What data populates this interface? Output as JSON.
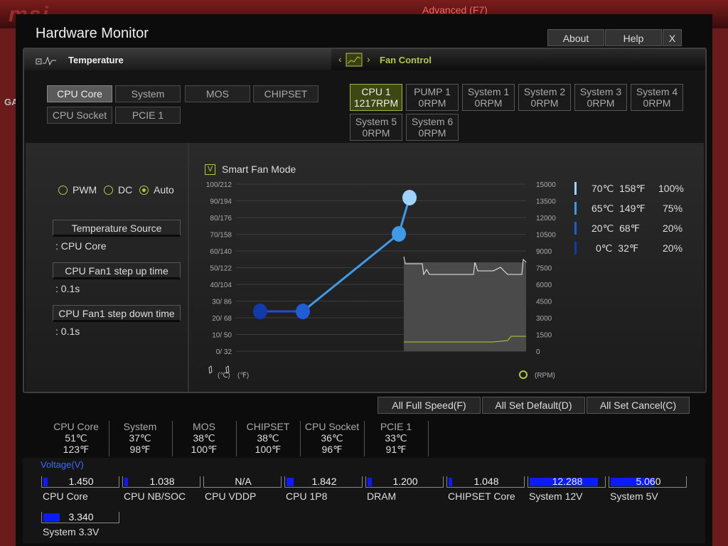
{
  "window": {
    "title": "Hardware Monitor",
    "about": "About",
    "help": "Help",
    "close": "X"
  },
  "background": {
    "brand": "msi",
    "advanced": "Advanced (F7)",
    "side_label": "GA"
  },
  "tabs": {
    "temperature": "Temperature",
    "fan_control": "Fan Control"
  },
  "temp_sources": [
    {
      "label": "CPU Core",
      "active": true
    },
    {
      "label": "System"
    },
    {
      "label": "MOS"
    },
    {
      "label": "CHIPSET"
    },
    {
      "label": "CPU Socket"
    },
    {
      "label": "PCIE 1"
    }
  ],
  "fans": [
    {
      "name": "CPU 1",
      "rpm": "1217RPM",
      "active": true
    },
    {
      "name": "PUMP 1",
      "rpm": "0RPM"
    },
    {
      "name": "System 1",
      "rpm": "0RPM"
    },
    {
      "name": "System 2",
      "rpm": "0RPM"
    },
    {
      "name": "System 3",
      "rpm": "0RPM"
    },
    {
      "name": "System 4",
      "rpm": "0RPM"
    },
    {
      "name": "System 5",
      "rpm": "0RPM"
    },
    {
      "name": "System 6",
      "rpm": "0RPM"
    }
  ],
  "mode": {
    "pwm": "PWM",
    "dc": "DC",
    "auto": "Auto",
    "selected": "Auto"
  },
  "settings": {
    "temp_source_label": "Temperature Source",
    "temp_source_value": ": CPU Core",
    "step_up_label": "CPU Fan1 step up time",
    "step_up_value": ": 0.1s",
    "step_down_label": "CPU Fan1 step down time",
    "step_down_value": ": 0.1s"
  },
  "smart_fan": {
    "label": "Smart Fan Mode",
    "checked": true,
    "check_glyph": "V"
  },
  "chart_data": {
    "type": "line",
    "title": "",
    "y_left_ticks": [
      "100/212",
      "90/194",
      "80/176",
      "70/158",
      "60/140",
      "50/122",
      "40/104",
      "30/ 86",
      "20/ 68",
      "10/ 50",
      "0/ 32"
    ],
    "y_right_ticks": [
      "15000",
      "13500",
      "12000",
      "10500",
      "9000",
      "7500",
      "6000",
      "4500",
      "3000",
      "1500",
      "0"
    ],
    "ylim_percent": [
      0,
      100
    ],
    "series": [
      {
        "values": [
          [
            0,
            20
          ],
          [
            20,
            20
          ],
          [
            65,
            75
          ],
          [
            70,
            100
          ]
        ]
      }
    ],
    "left_unit": "(℃)",
    "left_unit2": "(℉)",
    "right_unit": "(RPM)"
  },
  "curve_legend": [
    {
      "c": "70℃",
      "f": "158℉",
      "pct": "100%",
      "color": "#9fd3ff"
    },
    {
      "c": "65℃",
      "f": "149℉",
      "pct": "75%",
      "color": "#3f9be8"
    },
    {
      "c": "20℃",
      "f": "68℉",
      "pct": "20%",
      "color": "#1f5cd8"
    },
    {
      "c": "0℃",
      "f": "32℉",
      "pct": "20%",
      "color": "#123aa8"
    }
  ],
  "actions": {
    "full_speed": "All Full Speed(F)",
    "set_default": "All Set Default(D)",
    "set_cancel": "All Set Cancel(C)"
  },
  "temps": [
    {
      "name": "CPU Core",
      "c": "51℃",
      "f": "123℉"
    },
    {
      "name": "System",
      "c": "37℃",
      "f": "98℉"
    },
    {
      "name": "MOS",
      "c": "38℃",
      "f": "100℉"
    },
    {
      "name": "CHIPSET",
      "c": "38℃",
      "f": "100℉"
    },
    {
      "name": "CPU Socket",
      "c": "36℃",
      "f": "96℉"
    },
    {
      "name": "PCIE 1",
      "c": "33℃",
      "f": "91℉"
    }
  ],
  "voltage": {
    "title": "Voltage(V)",
    "items": [
      {
        "name": "CPU Core",
        "value": "1.450",
        "fill": 0.06
      },
      {
        "name": "CPU NB/SOC",
        "value": "1.038",
        "fill": 0.05
      },
      {
        "name": "CPU VDDP",
        "value": "N/A",
        "fill": 0
      },
      {
        "name": "CPU 1P8",
        "value": "1.842",
        "fill": 0.1
      },
      {
        "name": "DRAM",
        "value": "1.200",
        "fill": 0.06
      },
      {
        "name": "CHIPSET Core",
        "value": "1.048",
        "fill": 0.05
      },
      {
        "name": "System 12V",
        "value": "12.288",
        "fill": 0.92
      },
      {
        "name": "System 5V",
        "value": "5.060",
        "fill": 0.6
      },
      {
        "name": "System 3.3V",
        "value": "3.340",
        "fill": 0.22
      }
    ]
  }
}
